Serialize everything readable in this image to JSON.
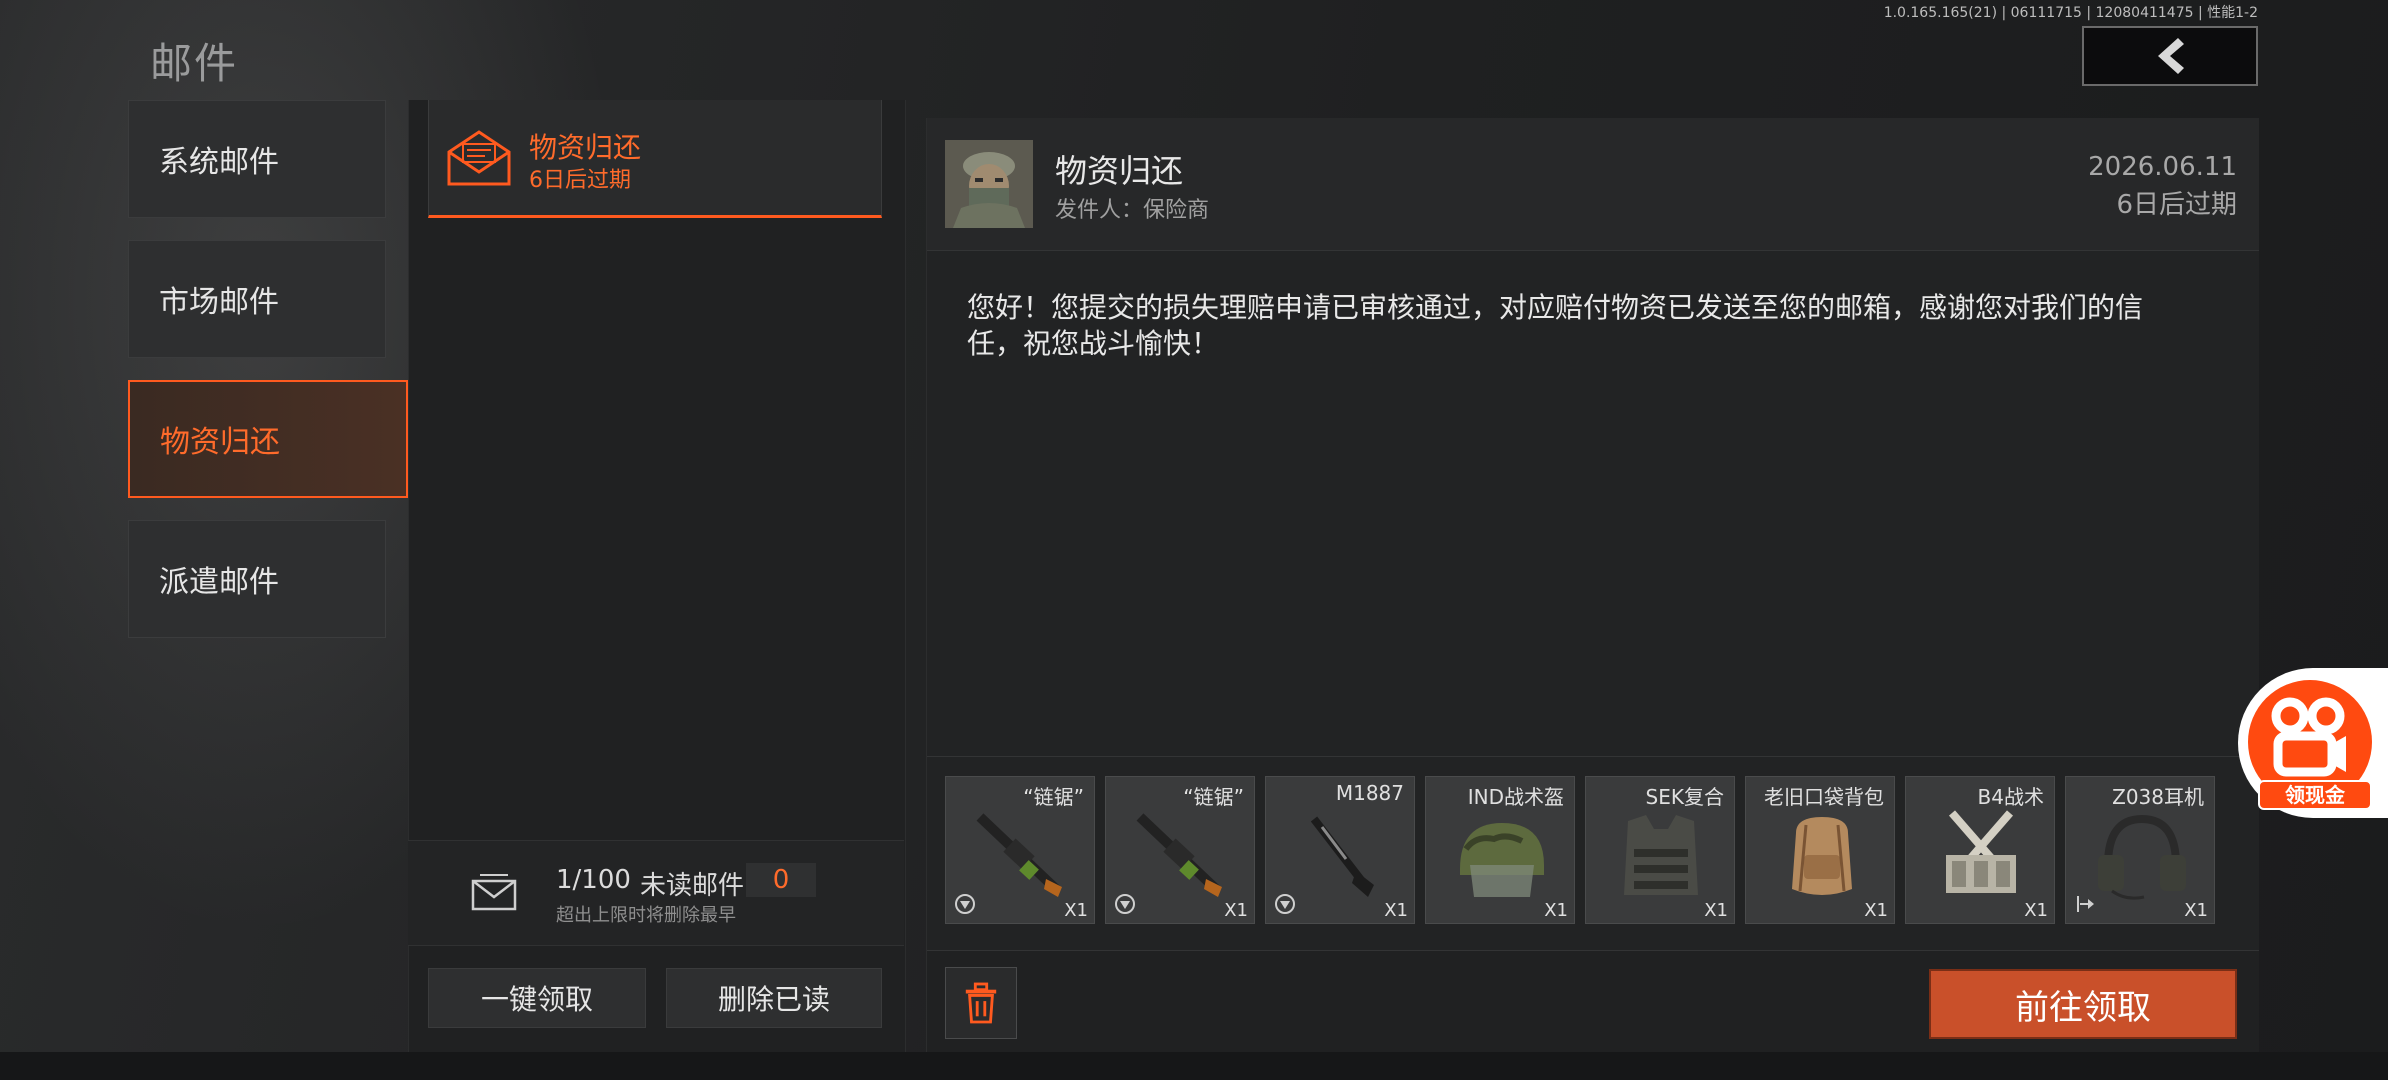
{
  "header": {
    "title": "邮件",
    "version": "1.0.165.165(21) | 06111715 | 12080411475 | 性能1-2"
  },
  "categories": [
    {
      "label": "系统邮件",
      "active": false
    },
    {
      "label": "市场邮件",
      "active": false
    },
    {
      "label": "物资归还",
      "active": true
    },
    {
      "label": "派遣邮件",
      "active": false
    }
  ],
  "mail_list": [
    {
      "title": "物资归还",
      "subtitle": "6日后过期"
    }
  ],
  "mailbox_stats": {
    "count": "1/100",
    "unread_label": "未读邮件",
    "unread_count": "0",
    "note": "超出上限时将删除最早"
  },
  "buttons": {
    "claim_all": "一键领取",
    "delete_read": "删除已读",
    "go_claim": "前往领取"
  },
  "detail": {
    "title": "物资归还",
    "sender": "发件人：保险商",
    "date": "2026.06.11",
    "expire": "6日后过期",
    "body": "您好！您提交的损失理赔申请已审核通过，对应赔付物资已发送至您的邮箱，感谢您对我们的信任，祝您战斗愉快！",
    "items": [
      {
        "name": "“链锯”",
        "qty": "X1",
        "icon": "chainsaw-icon"
      },
      {
        "name": "“链锯”",
        "qty": "X1",
        "icon": "chainsaw-icon"
      },
      {
        "name": "M1887",
        "qty": "X1",
        "icon": "shotgun-icon"
      },
      {
        "name": "IND战术盔",
        "qty": "X1",
        "icon": "helmet-icon"
      },
      {
        "name": "SEK复合",
        "qty": "X1",
        "icon": "vest-icon"
      },
      {
        "name": "老旧口袋背包",
        "qty": "X1",
        "icon": "backpack-icon"
      },
      {
        "name": "B4战术",
        "qty": "X1",
        "icon": "chest-rig-icon"
      },
      {
        "name": "Z038耳机",
        "qty": "X1",
        "icon": "headset-icon"
      }
    ]
  },
  "float_ad": {
    "label": "领现金"
  },
  "colors": {
    "accent": "#ff5a1f",
    "button": "#c9502a"
  }
}
